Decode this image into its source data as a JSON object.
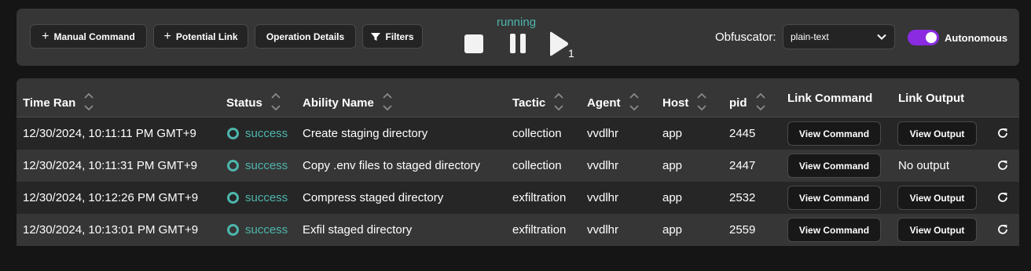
{
  "toolbar": {
    "manual_command": "Manual Command",
    "potential_link": "Potential Link",
    "operation_details": "Operation Details",
    "filters": "Filters",
    "state": "running",
    "play_count": "1",
    "obfuscator_label": "Obfuscator:",
    "obfuscator_value": "plain-text",
    "autonomous_label": "Autonomous",
    "autonomous_on": true
  },
  "table": {
    "headers": {
      "time_ran": "Time Ran",
      "status": "Status",
      "ability_name": "Ability Name",
      "tactic": "Tactic",
      "agent": "Agent",
      "host": "Host",
      "pid": "pid",
      "link_command": "Link Command",
      "link_output": "Link Output"
    },
    "rows": [
      {
        "time": "12/30/2024, 10:11:11 PM GMT+9",
        "status": "success",
        "ability": "Create staging directory",
        "tactic": "collection",
        "agent": "vvdlhr",
        "host": "app",
        "pid": "2445",
        "command": "View Command",
        "output": "View Output",
        "output_is_button": true
      },
      {
        "time": "12/30/2024, 10:11:31 PM GMT+9",
        "status": "success",
        "ability": "Copy .env files to staged directory",
        "tactic": "collection",
        "agent": "vvdlhr",
        "host": "app",
        "pid": "2447",
        "command": "View Command",
        "output": "No output",
        "output_is_button": false
      },
      {
        "time": "12/30/2024, 10:12:26 PM GMT+9",
        "status": "success",
        "ability": "Compress staged directory",
        "tactic": "exfiltration",
        "agent": "vvdlhr",
        "host": "app",
        "pid": "2532",
        "command": "View Command",
        "output": "View Output",
        "output_is_button": true
      },
      {
        "time": "12/30/2024, 10:13:01 PM GMT+9",
        "status": "success",
        "ability": "Exfil staged directory",
        "tactic": "exfiltration",
        "agent": "vvdlhr",
        "host": "app",
        "pid": "2559",
        "command": "View Command",
        "output": "View Output",
        "output_is_button": true
      }
    ]
  },
  "colors": {
    "accent_teal": "#4db6ac",
    "toggle_purple": "#8a2be2",
    "panel": "#363636",
    "background": "#151515"
  }
}
